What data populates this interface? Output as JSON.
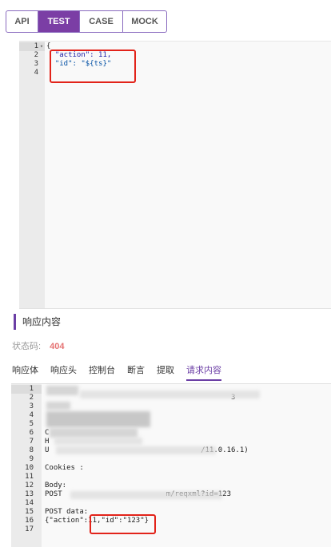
{
  "tabs": [
    {
      "label": "API",
      "active": false
    },
    {
      "label": "TEST",
      "active": true
    },
    {
      "label": "CASE",
      "active": false
    },
    {
      "label": "MOCK",
      "active": false
    }
  ],
  "editor": {
    "lines": [
      {
        "n": "1",
        "fold": "▾",
        "text": "{"
      },
      {
        "n": "2",
        "fold": "",
        "text": "  \"action\": 11,"
      },
      {
        "n": "3",
        "fold": "",
        "text": "  \"id\": \"${ts}\""
      },
      {
        "n": "4",
        "fold": "",
        "text": ""
      }
    ]
  },
  "response": {
    "title": "响应内容",
    "status_label": "状态码:",
    "status_code": "404",
    "tabs": [
      {
        "label": "响应体",
        "active": false
      },
      {
        "label": "响应头",
        "active": false
      },
      {
        "label": "控制台",
        "active": false
      },
      {
        "label": "断言",
        "active": false
      },
      {
        "label": "提取",
        "active": false
      },
      {
        "label": "请求内容",
        "active": true
      }
    ],
    "lines": [
      {
        "n": "1",
        "text": ""
      },
      {
        "n": "2",
        "text": "                                           3"
      },
      {
        "n": "3",
        "text": ""
      },
      {
        "n": "4",
        "text": ""
      },
      {
        "n": "5",
        "text": ""
      },
      {
        "n": "6",
        "text": "C"
      },
      {
        "n": "7",
        "text": "H"
      },
      {
        "n": "8",
        "text": "U                                   /11.0.16.1)"
      },
      {
        "n": "9",
        "text": ""
      },
      {
        "n": "10",
        "text": "Cookies :"
      },
      {
        "n": "11",
        "text": ""
      },
      {
        "n": "12",
        "text": "Body:"
      },
      {
        "n": "13",
        "text": "POST                        m/reqxml?id=123"
      },
      {
        "n": "14",
        "text": ""
      },
      {
        "n": "15",
        "text": "POST data:"
      },
      {
        "n": "16",
        "text": "{\"action\":11,\"id\":\"123\"}"
      },
      {
        "n": "17",
        "text": ""
      }
    ]
  },
  "colors": {
    "accent": "#7b3ea5",
    "annotation": "#e2231a",
    "status": "#e57373"
  }
}
